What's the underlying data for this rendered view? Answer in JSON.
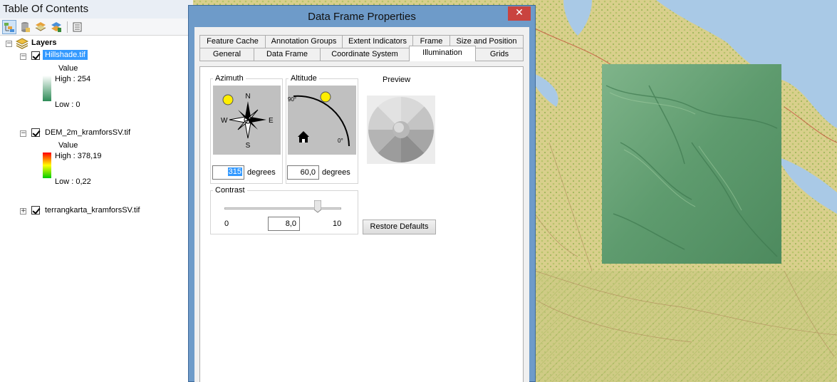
{
  "toc": {
    "title": "Table Of Contents",
    "toolbar_icons": [
      "list-by-drawing-order-icon",
      "list-by-source-icon",
      "list-by-visibility-icon",
      "list-by-selection-icon",
      "options-icon"
    ],
    "root_label": "Layers",
    "layers": [
      {
        "name": "Hillshade.tif",
        "legend_title": "Value",
        "high": "High : 254",
        "low": "Low : 0",
        "ramp_colors": [
          "#ffffff",
          "#2e8b57"
        ],
        "checked": true,
        "expanded": true,
        "selected": true
      },
      {
        "name": "DEM_2m_kramforsSV.tif",
        "legend_title": "Value",
        "high": "High : 378,19",
        "low": "Low : 0,22",
        "ramp_colors": [
          "#ff0000",
          "#ffff00",
          "#00cc00"
        ],
        "checked": true,
        "expanded": true
      },
      {
        "name": "terrangkarta_kramforsSV.tif",
        "checked": true,
        "expanded": false
      }
    ]
  },
  "dialog": {
    "title": "Data Frame Properties",
    "close_glyph": "✕",
    "tabs_row1": [
      "Feature Cache",
      "Annotation Groups",
      "Extent Indicators",
      "Frame",
      "Size and Position"
    ],
    "tabs_row2": [
      "General",
      "Data Frame",
      "Coordinate System",
      "Illumination",
      "Grids"
    ],
    "selected_tab": "Illumination",
    "azimuth": {
      "label": "Azimuth",
      "value": "315",
      "unit": "degrees",
      "compass": {
        "n": "N",
        "s": "S",
        "e": "E",
        "w": "W"
      }
    },
    "altitude": {
      "label": "Altitude",
      "value": "60,0",
      "unit": "degrees",
      "top_mark": "90°",
      "bottom_mark": "0°"
    },
    "preview_label": "Preview",
    "contrast": {
      "label": "Contrast",
      "min": "0",
      "max": "10",
      "value": "8,0",
      "fraction": 0.8
    },
    "restore_defaults": "Restore Defaults"
  },
  "colors": {
    "hillshade_green": "#5e9b6e",
    "selection_blue": "#3399ff",
    "dialog_frame": "#6e9bc9",
    "close_red": "#c9433f",
    "sun_yellow": "#ffee00"
  }
}
